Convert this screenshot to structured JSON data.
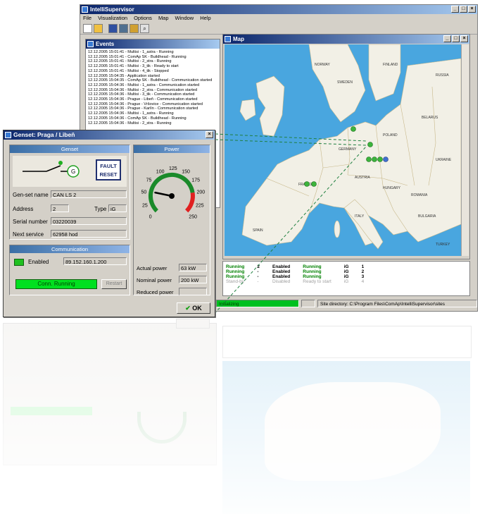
{
  "main_window": {
    "title": "IntelliSupervisor",
    "menu": [
      "File",
      "Visualization",
      "Options",
      "Map",
      "Window",
      "Help"
    ]
  },
  "events": {
    "title": "Events",
    "lines": [
      "12.12.2005 15:01:41 - Multisi - 1_astra - Running",
      "12.12.2005 15:01:41 - ComAp SK - Buildhead - Running",
      "12.12.2005 15:01:41 - Multisi - 2_stra - Running",
      "12.12.2005 15:01:41 - Multisi - 3_tik - Ready to start",
      "12.12.2005 15:01:41 - Multisi - 4_tik - Stopped",
      "12.12.2005 15:04:35 - Application started",
      "12.12.2005 15:04:35 - ComAp SK - Buildhead - Communication started",
      "12.12.2005 15:04:36 - Multisi - 1_astra - Communication started",
      "12.12.2005 15:04:36 - Multisi - 2_stra - Communication started",
      "12.12.2005 15:04:36 - Multisi - 3_tik - Communication started",
      "12.12.2005 15:04:36 - Prague - Libeň - Communication started",
      "12.12.2005 15:04:36 - Prague - Vršovice - Communication started",
      "12.12.2005 15:04:36 - Prague - Karlín - Communication started",
      "12.12.2005 15:04:36 - Multisi - 1_astra - Running",
      "12.12.2005 15:04:36 - ComAp SK - Buildhead - Running",
      "12.12.2005 15:04:36 - Multisi - 2_stra - Running"
    ]
  },
  "map": {
    "title": "Map",
    "countries": [
      "FRANCE",
      "GERMANY",
      "POLAND",
      "SPAIN",
      "ITALY",
      "RUSSIA",
      "SWEDEN",
      "NORWAY",
      "BELARUS",
      "UKRAINE",
      "ROMANIA",
      "BULGARIA",
      "AUSTRIA",
      "HUNGARY",
      "FINLAND",
      "TURKEY"
    ]
  },
  "status_table": {
    "rows": [
      [
        "Running",
        "2",
        "Enabled",
        "Running",
        "iG",
        "1"
      ],
      [
        "Running",
        "-",
        "Enabled",
        "Running",
        "iG",
        "2"
      ],
      [
        "Running",
        "-",
        "Enabled",
        "Running",
        "iG",
        "3"
      ],
      [
        "Stand-by",
        "-",
        "Disabled",
        "Ready to start",
        "iG",
        "4"
      ]
    ]
  },
  "statusbar": {
    "left": "",
    "progress_label": "Initializing",
    "site_directory": "Site directory: C:\\Program Files\\ComAp\\IntelliSupervisor\\sites"
  },
  "dialog": {
    "title": "Genset: Praga / Libeň",
    "genset_header": "Genset",
    "power_header": "Power",
    "fault_reset": "FAULT RESET",
    "gen_label": "G",
    "gen_set_name_label": "Gen-set name",
    "gen_set_name": "CAN LS 2",
    "address_label": "Address",
    "address": "2",
    "type_label": "Type",
    "type": "iG",
    "serial_label": "Serial number",
    "serial": "03220039",
    "next_service_label": "Next service",
    "next_service": "62958 hod",
    "communication_header": "Communication",
    "enabled_label": "Enabled",
    "ip": "89.152.160.1.200",
    "comm_status": "Conn. Running",
    "restart_label": "Restart",
    "gauge_labels": [
      "0",
      "25",
      "50",
      "75",
      "100",
      "125",
      "150",
      "175",
      "200",
      "225",
      "250"
    ],
    "gauge_value_fraction": 0.21,
    "actual_power_label": "Actual power",
    "actual_power": "63 kW",
    "nominal_power_label": "Nominal power",
    "nominal_power": "200 kW",
    "reduced_power_label": "Reduced power",
    "reduced_power": "",
    "ok_label": "OK"
  },
  "colors": {
    "accent": "#0a246a",
    "running": "#00c020",
    "sea": "#49a6df",
    "land": "#f2f0e6",
    "marker_green": "#3cb43c",
    "marker_blue": "#4070d0"
  }
}
